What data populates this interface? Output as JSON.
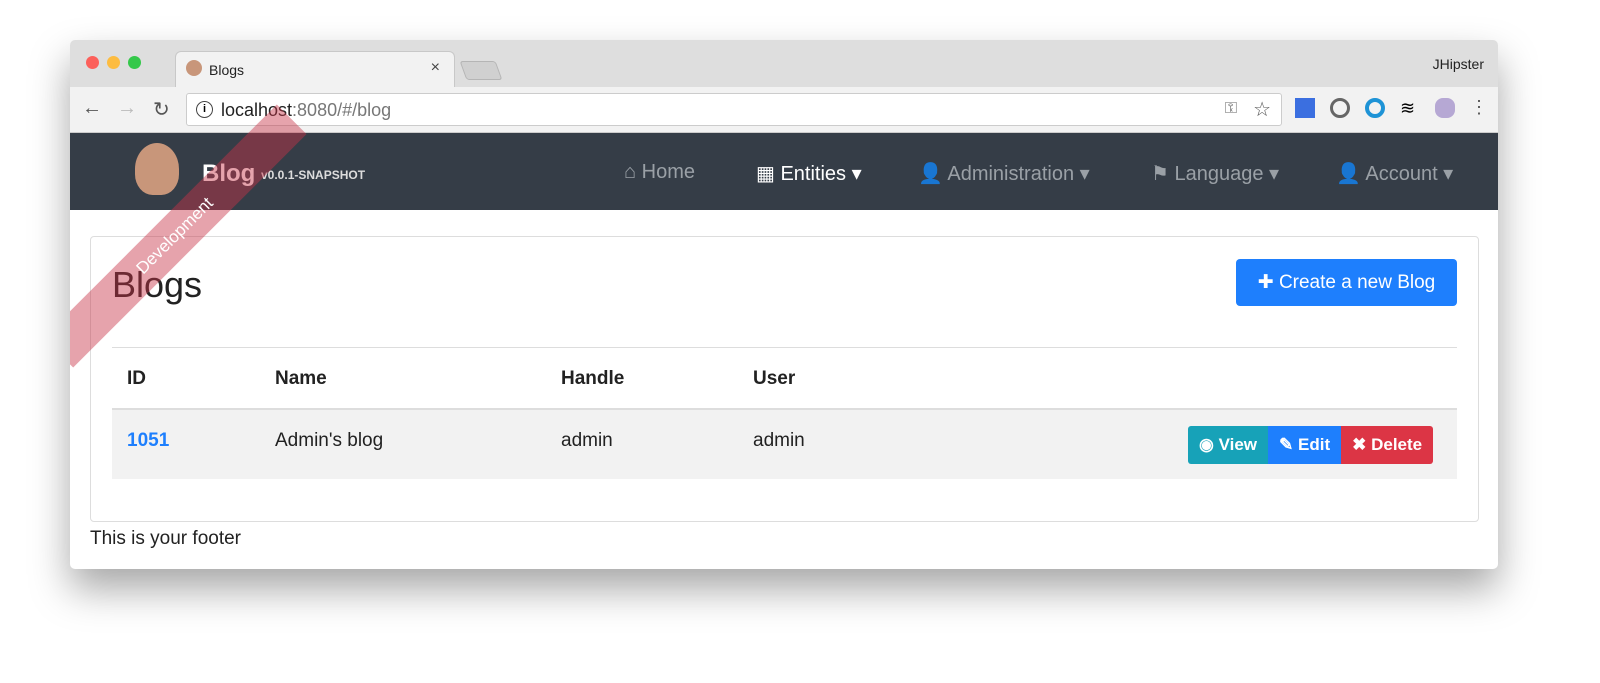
{
  "browser": {
    "tab_title": "Blogs",
    "profile": "JHipster",
    "url_host": "localhost",
    "url_rest": ":8080/#/blog"
  },
  "navbar": {
    "brand": "Blog",
    "version": "v0.0.1-SNAPSHOT",
    "ribbon": "Development",
    "items": [
      {
        "label": "Home",
        "icon": "home-icon"
      },
      {
        "label": "Entities",
        "icon": "table-icon"
      },
      {
        "label": "Administration",
        "icon": "user-plus-icon"
      },
      {
        "label": "Language",
        "icon": "flag-icon"
      },
      {
        "label": "Account",
        "icon": "user-icon"
      }
    ]
  },
  "page": {
    "title": "Blogs",
    "create_label": "Create a new Blog",
    "columns": [
      "ID",
      "Name",
      "Handle",
      "User"
    ],
    "rows": [
      {
        "id": "1051",
        "name": "Admin's blog",
        "handle": "admin",
        "user": "admin"
      }
    ],
    "actions": {
      "view": "View",
      "edit": "Edit",
      "delete": "Delete"
    },
    "colors": {
      "primary": "#1e7ffd",
      "info": "#17a2b8",
      "danger": "#dc3545",
      "navbar": "#353d47"
    }
  },
  "footer": "This is your footer"
}
